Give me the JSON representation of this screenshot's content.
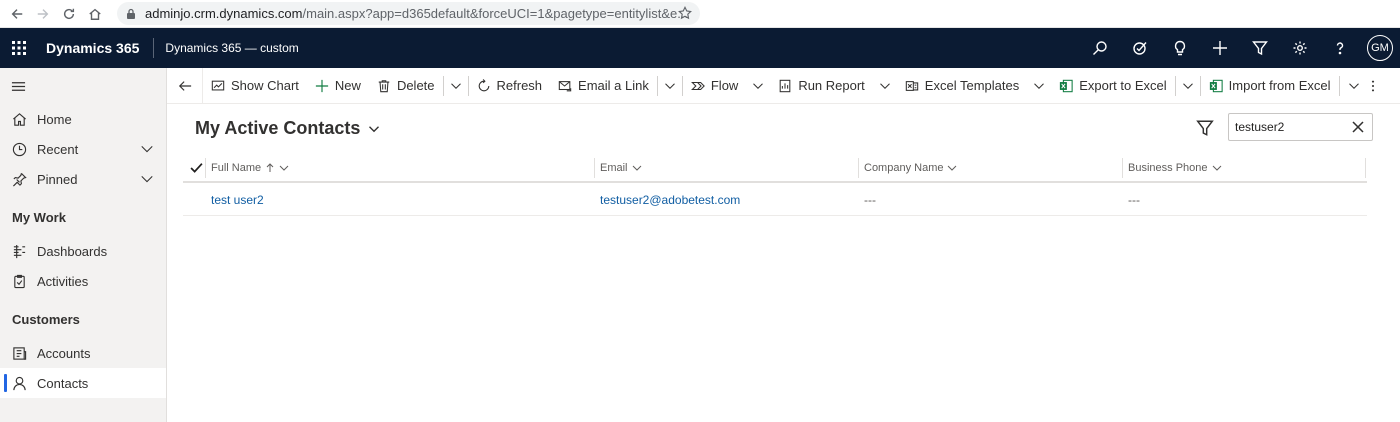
{
  "browser": {
    "url_host": "adminjo.crm.dynamics.com",
    "url_path": "/main.aspx?app=d365default&forceUCI=1&pagetype=entitylist&e..."
  },
  "header": {
    "brand": "Dynamics 365",
    "app_name": "Dynamics 365 — custom",
    "avatar_initials": "GM",
    "icons": [
      "search-icon",
      "task-icon",
      "lightbulb-icon",
      "plus-icon",
      "filter-icon",
      "gear-icon",
      "help-icon"
    ]
  },
  "sidebar": {
    "items": [
      {
        "label": "Home",
        "icon": "home-icon"
      },
      {
        "label": "Recent",
        "icon": "clock-icon"
      },
      {
        "label": "Pinned",
        "icon": "pin-icon"
      }
    ],
    "sections": [
      {
        "title": "My Work",
        "items": [
          {
            "label": "Dashboards",
            "icon": "dashboard-icon"
          },
          {
            "label": "Activities",
            "icon": "clipboard-icon"
          }
        ]
      },
      {
        "title": "Customers",
        "items": [
          {
            "label": "Accounts",
            "icon": "building-icon"
          },
          {
            "label": "Contacts",
            "icon": "person-icon"
          }
        ]
      }
    ],
    "active": "Contacts"
  },
  "commandbar": {
    "show_chart": "Show Chart",
    "new": "New",
    "delete": "Delete",
    "refresh": "Refresh",
    "email_link": "Email a Link",
    "flow": "Flow",
    "run_report": "Run Report",
    "excel_templates": "Excel Templates",
    "export_excel": "Export to Excel",
    "import_excel": "Import from Excel"
  },
  "view": {
    "title": "My Active Contacts",
    "search_value": "testuser2"
  },
  "grid": {
    "columns": [
      "Full Name",
      "Email",
      "Company Name",
      "Business Phone"
    ],
    "rows": [
      {
        "full_name": "test user2",
        "email": "testuser2@adobetest.com",
        "company": "---",
        "phone": "---"
      }
    ]
  },
  "colors": {
    "header_bg": "#0b1b33",
    "link": "#115ea3",
    "active_bar": "#2266e3",
    "excel_green": "#107c41"
  }
}
